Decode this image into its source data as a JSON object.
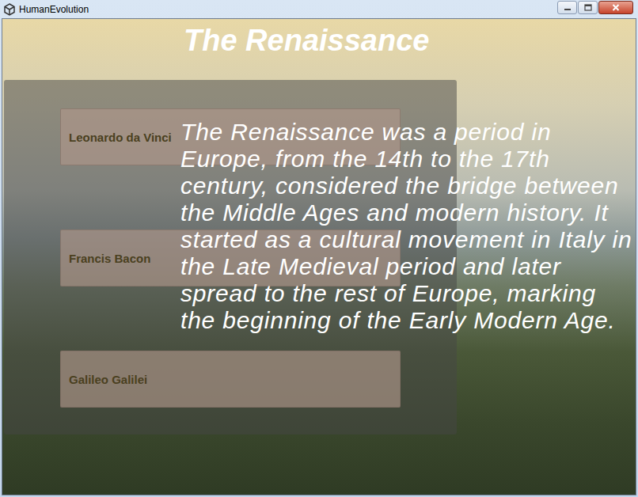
{
  "window": {
    "title": "HumanEvolution"
  },
  "heading": "The Renaissance",
  "people": [
    {
      "label": "Leonardo da Vinci"
    },
    {
      "label": "Francis Bacon"
    },
    {
      "label": "Galileo Galilei"
    }
  ],
  "description": "The Renaissance was a period in Europe, from the 14th to the 17th century, considered the bridge between the Middle Ages and modern history. It started as a cultural movement in Italy in the Late Medieval period and later spread to the rest of Europe, marking the beginning of the Early Modern Age."
}
